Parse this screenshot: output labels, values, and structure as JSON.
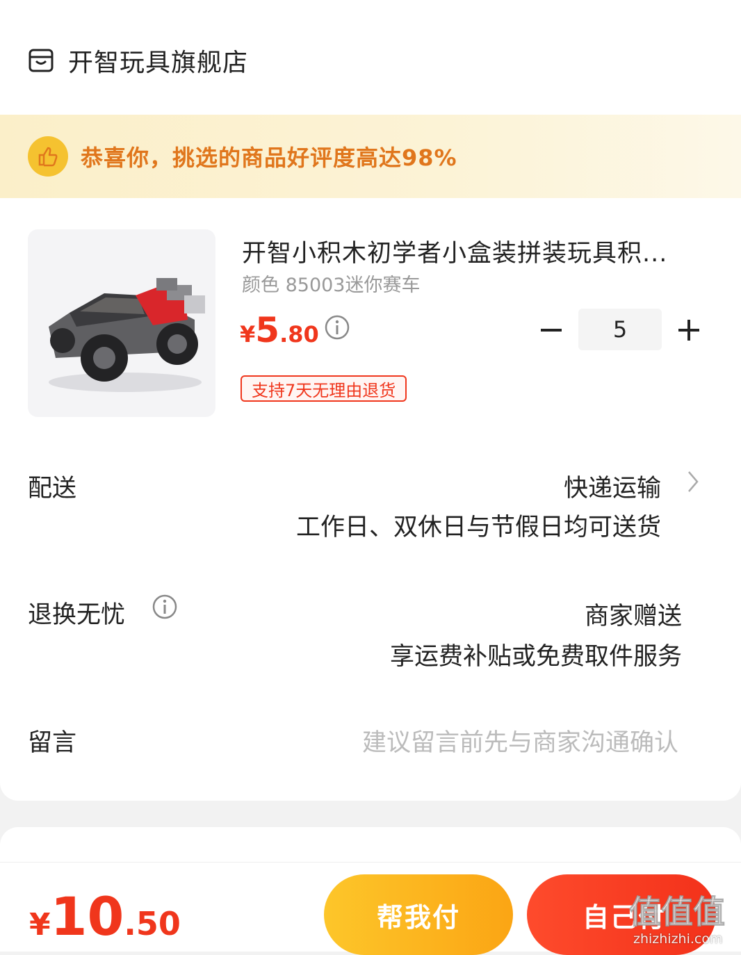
{
  "shop": {
    "name": "开智玩具旗舰店",
    "icon": "store-icon"
  },
  "banner": {
    "text": "恭喜你，挑选的商品好评度高达98%",
    "icon": "thumbs-up-icon"
  },
  "product": {
    "title": "开智小积木初学者小盒装拼装玩具积...",
    "spec": "颜色 85003迷你赛车",
    "price_currency": "¥",
    "price_int": "5",
    "price_dec": ".80",
    "quantity": "5",
    "return_badge": "支持7天无理由退货"
  },
  "delivery": {
    "label": "配送",
    "method": "快递运输",
    "note": "工作日、双休日与节假日均可送货"
  },
  "returns": {
    "label": "退换无忧",
    "value": "商家赠送",
    "note": "享运费补贴或免费取件服务"
  },
  "message": {
    "label": "留言",
    "placeholder": "建议留言前先与商家沟通确认"
  },
  "footer": {
    "total_currency": "¥",
    "total_int": "10",
    "total_dec": ".50",
    "help_pay": "帮我付",
    "self_pay": "自己付"
  },
  "watermark": {
    "main": "值值值",
    "sub": "zhizhizhi.com"
  },
  "colors": {
    "accent": "#f0361c",
    "banner_text": "#e0761c",
    "help_button": "#fdc62a"
  }
}
